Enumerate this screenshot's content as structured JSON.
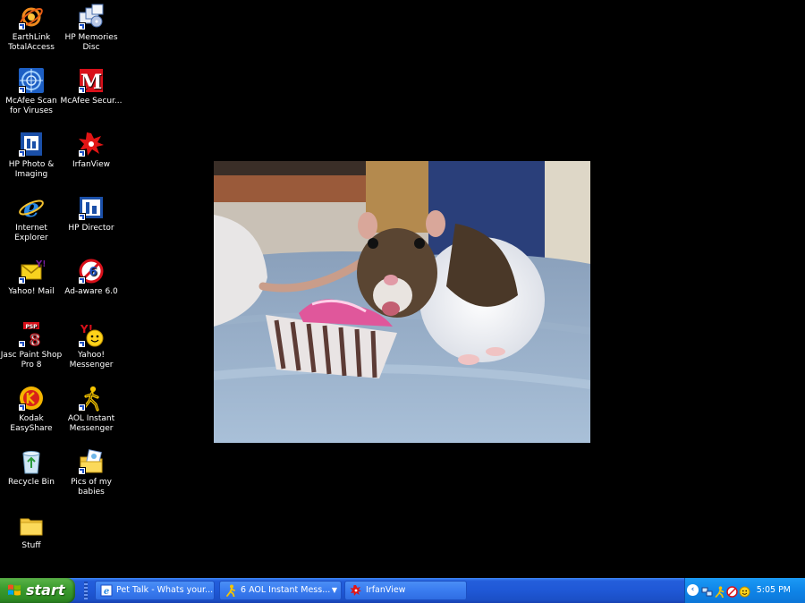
{
  "desktop": {
    "icons": [
      {
        "label": "EarthLink TotalAccess",
        "icon": "earthlink-icon"
      },
      {
        "label": "HP Memories Disc",
        "icon": "hp-memories-icon"
      },
      {
        "label": "McAfee Scan for Viruses",
        "icon": "mcafee-scan-icon"
      },
      {
        "label": "McAfee Secur...",
        "icon": "mcafee-security-icon"
      },
      {
        "label": "HP Photo & Imaging",
        "icon": "hp-photo-icon"
      },
      {
        "label": "IrfanView",
        "icon": "irfanview-icon"
      },
      {
        "label": "Internet Explorer",
        "icon": "internet-explorer-icon"
      },
      {
        "label": "HP Director",
        "icon": "hp-director-icon"
      },
      {
        "label": "Yahoo! Mail",
        "icon": "yahoo-mail-icon"
      },
      {
        "label": "Ad-aware 6.0",
        "icon": "adaware-icon"
      },
      {
        "label": "Jasc Paint Shop Pro 8",
        "icon": "paint-shop-pro-icon"
      },
      {
        "label": "Yahoo! Messenger",
        "icon": "yahoo-messenger-icon"
      },
      {
        "label": "Kodak EasyShare",
        "icon": "kodak-icon"
      },
      {
        "label": "AOL Instant Messenger",
        "icon": "aol-aim-icon"
      },
      {
        "label": "Recycle Bin",
        "icon": "recycle-bin-icon"
      },
      {
        "label": "Pics of my babies",
        "icon": "picture-folder-icon"
      },
      {
        "label": "Stuff",
        "icon": "folder-icon"
      }
    ]
  },
  "taskbar": {
    "start_label": "start",
    "buttons": [
      {
        "label": "Pet Talk - Whats your...",
        "icon": "ie-page-icon"
      },
      {
        "label": "6 AOL Instant Mess...",
        "icon": "aim-running-man-icon",
        "dropdown": "▼"
      },
      {
        "label": "IrfanView",
        "icon": "irfanview-icon"
      }
    ],
    "tray": {
      "chevron": "‹",
      "icons": [
        "network-icon",
        "aim-tray-icon",
        "antivirus-tray-icon",
        "yahoo-tray-icon"
      ],
      "clock": "5:05 PM"
    }
  },
  "colors": {
    "desktop_bg": "#000000",
    "taskbar_blue": "#245edb",
    "start_green": "#3c9c2f",
    "tray_blue": "#0f85e8"
  }
}
